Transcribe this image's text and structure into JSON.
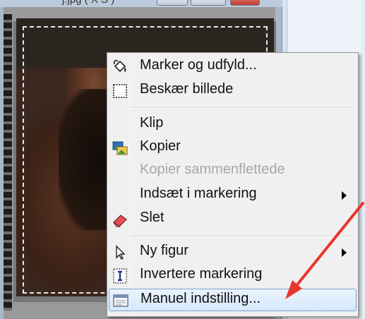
{
  "window": {
    "title": "j.jpg ( X S )"
  },
  "context_menu": {
    "items": [
      {
        "label": "Marker og udfyld...",
        "icon": "paint-bucket-icon"
      },
      {
        "label": "Beskær billede",
        "icon": "crop-selection-icon"
      },
      {
        "label": "Klip",
        "icon": null
      },
      {
        "label": "Kopier",
        "icon": "copy-image-icon"
      },
      {
        "label": "Kopier sammenflettede",
        "icon": null,
        "disabled": true
      },
      {
        "label": "Indsæt i markering",
        "icon": null,
        "submenu": true
      },
      {
        "label": "Slet",
        "icon": "eraser-icon"
      },
      {
        "label": "Ny figur",
        "icon": "cursor-arrow-icon",
        "submenu": true
      },
      {
        "label": "Invertere markering",
        "icon": "invert-selection-icon"
      },
      {
        "label": "Manuel indstilling...",
        "icon": "manual-settings-icon",
        "highlighted": true
      }
    ]
  },
  "colors": {
    "menu_background": "#f0f0f0",
    "highlight": "#d5e8fb",
    "disabled_text": "#a7a7a7",
    "annotation_arrow": "#e8352d"
  }
}
